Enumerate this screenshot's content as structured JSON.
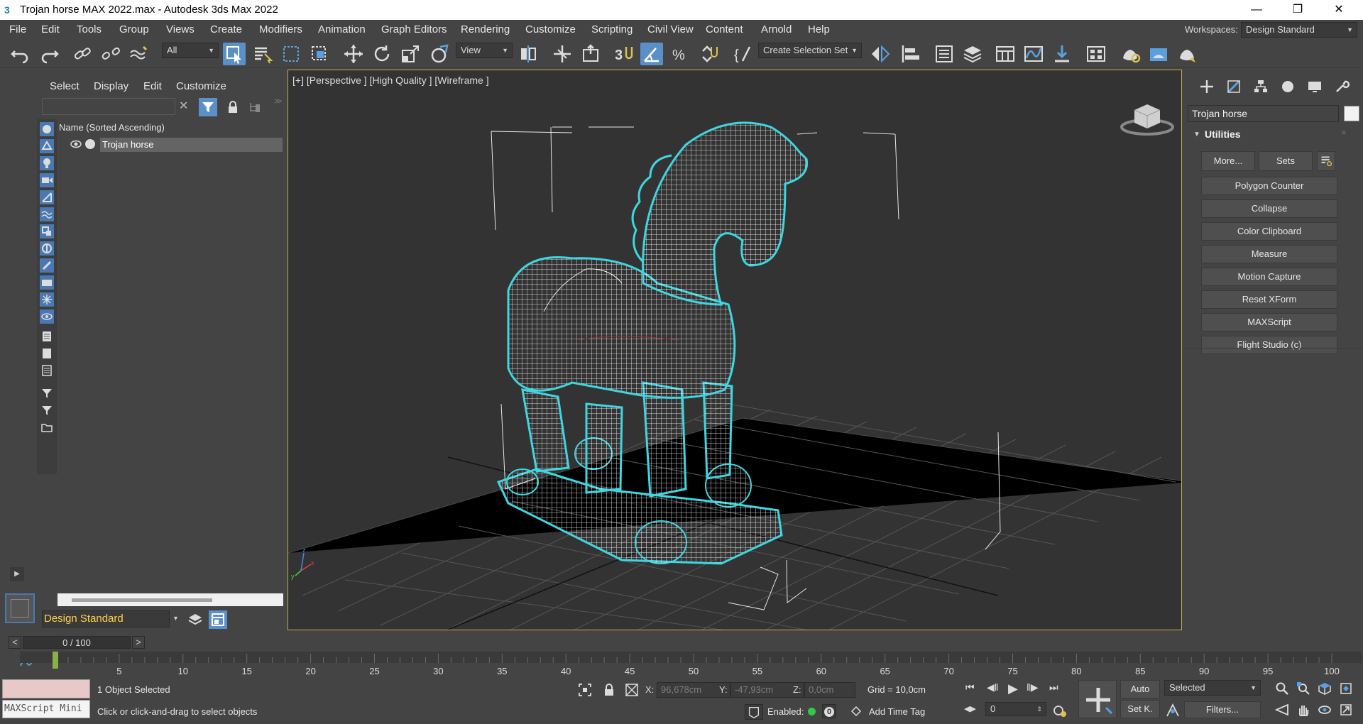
{
  "window": {
    "title": "Trojan horse MAX 2022.max - Autodesk 3ds Max 2022",
    "app_icon": "3",
    "controls": [
      "minimize-icon",
      "restore-icon",
      "close-icon"
    ]
  },
  "menu": {
    "items": [
      "File",
      "Edit",
      "Tools",
      "Group",
      "Views",
      "Create",
      "Modifiers",
      "Animation",
      "Graph Editors",
      "Rendering",
      "Customize",
      "Scripting",
      "Civil View",
      "Content",
      "Arnold",
      "Help"
    ],
    "workspaces_label": "Workspaces:",
    "workspace_value": "Design Standard"
  },
  "toolbar": {
    "selection_filter": "All",
    "reference_coord": "View",
    "selection_set": "Create Selection Set"
  },
  "scene_explorer": {
    "tabs": [
      "Select",
      "Display",
      "Edit",
      "Customize"
    ],
    "column_header": "Name (Sorted Ascending)",
    "rows": [
      {
        "label": "Trojan horse"
      }
    ],
    "workspace": "Design Standard"
  },
  "viewport": {
    "label": "[+] [Perspective ] [High Quality ] [Wireframe ]"
  },
  "command_panel": {
    "object_name": "Trojan horse",
    "rollout_title": "Utilities",
    "more_button": "More...",
    "sets_button": "Sets",
    "utilities": [
      "Polygon Counter",
      "Collapse",
      "Color Clipboard",
      "Measure",
      "Motion Capture",
      "Reset XForm",
      "MAXScript",
      "Flight Studio (c)"
    ]
  },
  "timeline": {
    "slider_value": "0 / 100",
    "prev": "<",
    "next": ">",
    "ticks": [
      "5",
      "10",
      "15",
      "20",
      "25",
      "30",
      "35",
      "40",
      "45",
      "50",
      "55",
      "60",
      "65",
      "70",
      "75",
      "80",
      "85",
      "90",
      "95",
      "100"
    ],
    "current_frame": 0,
    "total_frames": 100
  },
  "status": {
    "maxscript_placeholder": "MAXScript Mini",
    "selection": "1 Object Selected",
    "prompt": "Click or click-and-drag to select objects",
    "x_label": "X:",
    "x_value": "96,678cm",
    "y_label": "Y:",
    "y_value": "-47,93cm",
    "z_label": "Z:",
    "z_value": "0,0cm",
    "grid": "Grid = 10,0cm",
    "enabled": "Enabled:",
    "add_time_tag": "Add Time Tag",
    "key_auto": "Auto",
    "key_set": "Set K.",
    "key_filter_value": "Selected",
    "frame_field": "0",
    "filters": "Filters...",
    "zero_badge": "0"
  },
  "colors": {
    "selection_highlight": "#3fd6e0",
    "viewport_bg": "#333333",
    "ui_bg": "#444444",
    "active_button": "#5b8fc7",
    "workspace_text": "#ffd24a"
  }
}
